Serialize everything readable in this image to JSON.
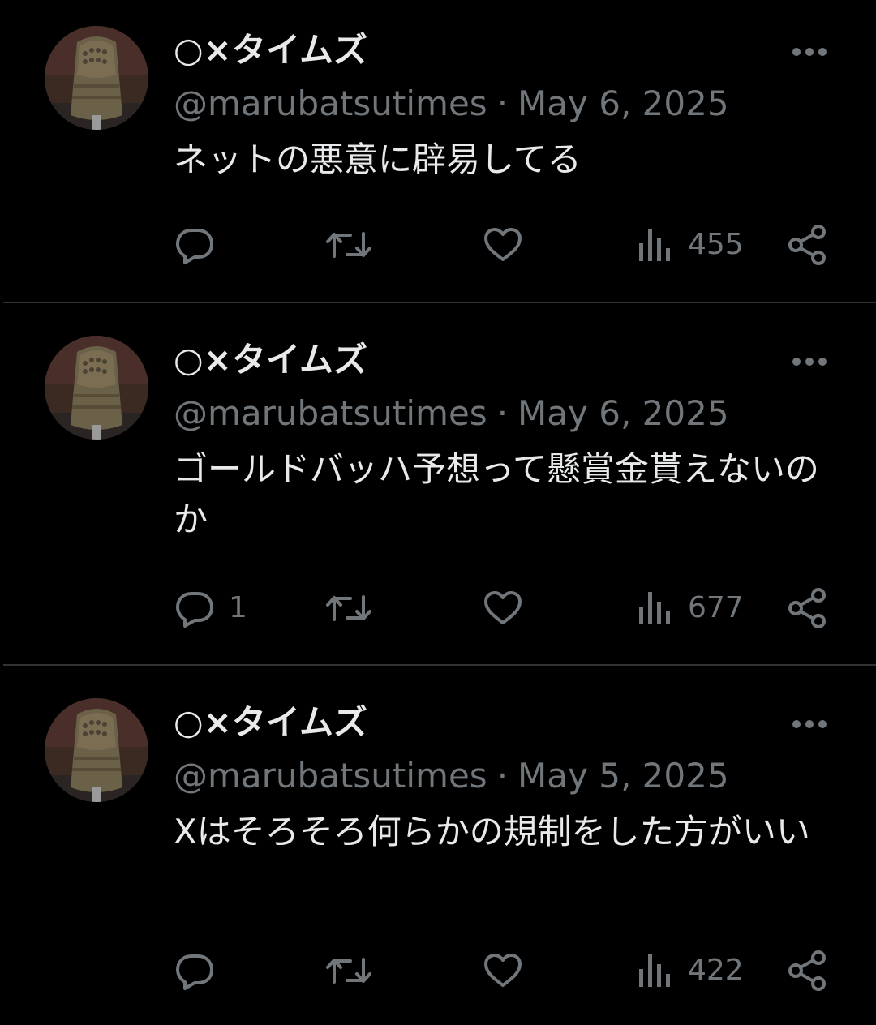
{
  "colors": {
    "background": "#000000",
    "primary_text": "#e7e9ea",
    "secondary_text": "#71767b",
    "divider": "#2f3336"
  },
  "tweets": [
    {
      "display_name": "○×タイムズ",
      "handle": "@marubatsutimes",
      "separator": "·",
      "date": "May 6, 2025",
      "text": "ネットの悪意に辟易してる",
      "reply_count": "",
      "view_count": "455"
    },
    {
      "display_name": "○×タイムズ",
      "handle": "@marubatsutimes",
      "separator": "·",
      "date": "May 6, 2025",
      "text": "ゴールドバッハ予想って懸賞金貰えないのか",
      "reply_count": "1",
      "view_count": "677"
    },
    {
      "display_name": "○×タイムズ",
      "handle": "@marubatsutimes",
      "separator": "·",
      "date": "May 5, 2025",
      "text": "Xはそろそろ何らかの規制をした方がいい",
      "reply_count": "",
      "view_count": "422"
    }
  ],
  "icons": {
    "more": "more-horizontal-icon",
    "reply": "reply-bubble-icon",
    "retweet": "retweet-icon",
    "like": "heart-icon",
    "views": "views-bar-chart-icon",
    "share": "share-icon"
  }
}
